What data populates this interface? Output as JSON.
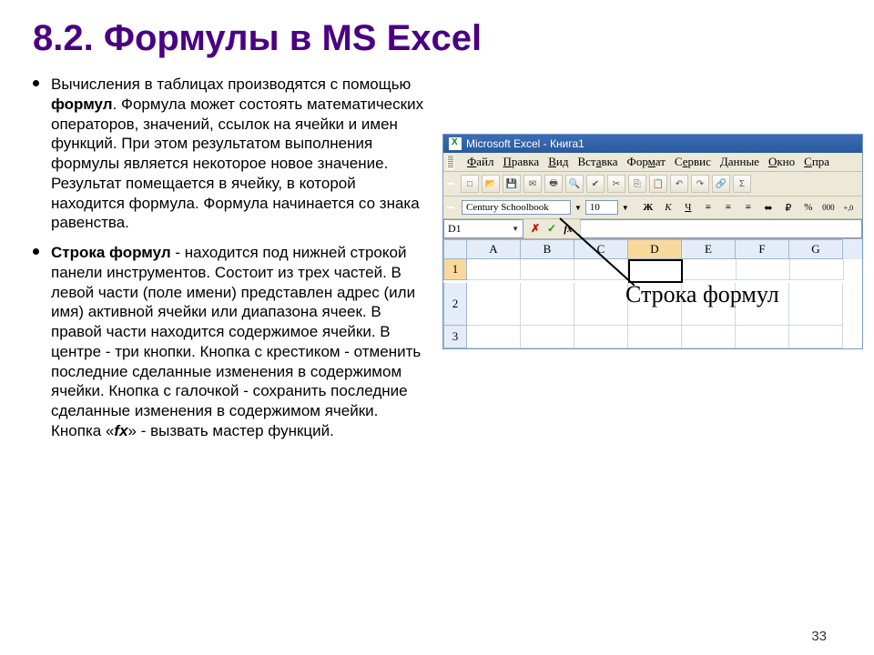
{
  "slide": {
    "title": "8.2. Формулы в MS Excel",
    "page_number": "33",
    "bullets": [
      {
        "pre": "Вычисления в таблицах производятся с помощью ",
        "bold1": "формул",
        "post": ". Формула может состоять математических операторов, значений, ссылок на ячейки и имен функций. При этом результатом выполнения формулы является некоторое новое значение. Результат помещается в ячейку, в которой находится формула. Формула начинается со знака равенства."
      },
      {
        "bold1": "Строка формул",
        "mid": " - находится под нижней строкой панели инструментов. Состоит из трех частей. В левой части (поле имени) представлен адрес (или имя) активной ячейки или диапазона ячеек. В правой части находится содержимое ячейки. В центре - три кнопки. Кнопка с крестиком - отменить последние сделанные изменения в содержимом ячейки. Кнопка с галочкой - сохранить последние сделанные изменения в содержимом ячейки. Кнопка «",
        "bolditalic": "fx",
        "post": "» - вызвать мастер функций."
      }
    ]
  },
  "excel": {
    "title": "Microsoft Excel - Книга1",
    "menu": [
      "Файл",
      "Правка",
      "Вид",
      "Вставка",
      "Формат",
      "Сервис",
      "Данные",
      "Окно",
      "Спра"
    ],
    "font_name": "Century Schoolbook",
    "font_size": "10",
    "format_buttons": {
      "bold": "Ж",
      "italic": "К",
      "underline": "Ч"
    },
    "name_box": "D1",
    "fx": {
      "cancel": "✗",
      "enter": "✓",
      "fx": "fx"
    },
    "columns": [
      "A",
      "B",
      "C",
      "D",
      "E",
      "F",
      "G"
    ],
    "rows": [
      "1",
      "2",
      "3"
    ],
    "active_col": "D",
    "active_row": "1",
    "annotation": "Строка формул"
  }
}
